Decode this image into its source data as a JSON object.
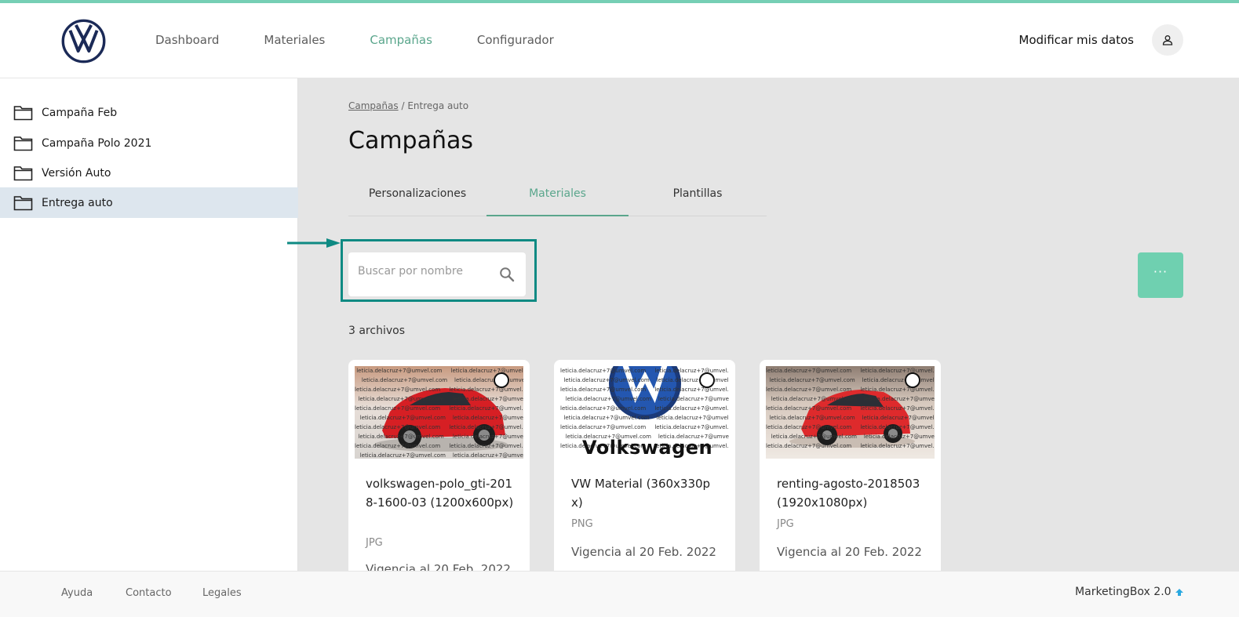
{
  "header": {
    "nav": [
      "Dashboard",
      "Materiales",
      "Campañas",
      "Configurador"
    ],
    "modify_label": "Modificar mis datos"
  },
  "sidebar": {
    "folders": [
      "Campaña Feb",
      "Campaña Polo 2021",
      "Versión Auto",
      "Entrega auto"
    ],
    "selected": "Entrega auto"
  },
  "breadcrumb": {
    "parent": "Campañas",
    "separator": "/",
    "current": "Entrega auto"
  },
  "page_title": "Campañas",
  "tabs": [
    "Personalizaciones",
    "Materiales",
    "Plantillas"
  ],
  "active_tab": "Materiales",
  "search": {
    "placeholder": "Buscar por nombre"
  },
  "more_button": "···",
  "file_count": "3 archivos",
  "cards": [
    {
      "name": "volkswagen-polo_gti-2018-1600-03 (1200x600px)",
      "type": "JPG",
      "validity": "Vigencia al 20 Feb. 2022",
      "watermark": "leticia.delacruz+7@umvel.com"
    },
    {
      "name": "VW Material (360x330px)",
      "type": "PNG",
      "validity": "Vigencia al 20 Feb. 2022",
      "watermark": "leticia.delacruz+7@umvel.com",
      "image_text": "Volkswagen"
    },
    {
      "name": "renting-agosto-2018503 (1920x1080px)",
      "type": "JPG",
      "validity": "Vigencia al 20 Feb. 2022",
      "watermark": "leticia.delacruz+7@umvel.com"
    }
  ],
  "footer": {
    "links": [
      "Ayuda",
      "Contacto",
      "Legales"
    ],
    "brand": "MarketingBox 2.0"
  },
  "colors": {
    "accent": "#5aa68c",
    "accent_button": "#6fd0b0",
    "highlight_frame": "#0e8a83",
    "selected_row": "#dde6ee"
  }
}
